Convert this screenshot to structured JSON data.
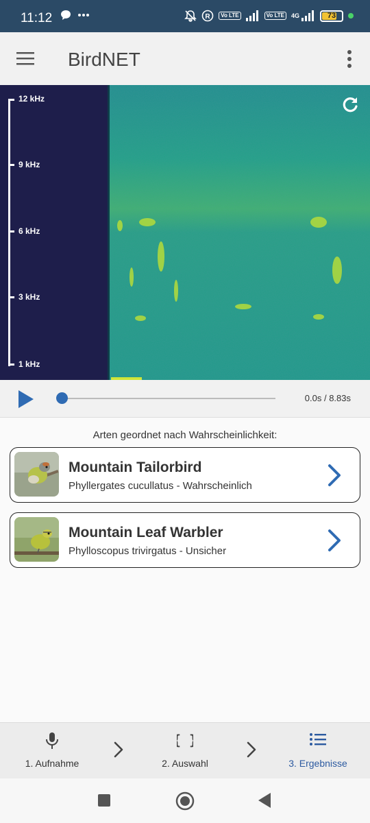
{
  "status_bar": {
    "time": "11:12",
    "battery_level": "73",
    "icons": [
      "chat-bubble-icon",
      "more-dots-icon",
      "mute-bell-icon",
      "registered-icon",
      "volte-icon",
      "signal-icon",
      "4g-icon",
      "battery-icon"
    ],
    "volte_label_1": "Vo LTE",
    "volte_label_2": "Vo LTE",
    "network_label": "4G"
  },
  "app_bar": {
    "title": "BirdNET",
    "icons": [
      "hamburger-menu-icon",
      "overflow-menu-icon"
    ]
  },
  "spectrogram": {
    "frequency_labels": [
      "12 kHz",
      "9 kHz",
      "6 kHz",
      "3 kHz",
      "1 kHz"
    ],
    "refresh_icon": "refresh-icon"
  },
  "player": {
    "time_display": "0.0s / 8.83s",
    "progress": 0.0,
    "play_icon": "play-icon"
  },
  "results": {
    "heading": "Arten geordnet nach Wahrscheinlichkeit:",
    "items": [
      {
        "common_name": "Mountain Tailorbird",
        "detail": "Phyllergates cucullatus - Wahrscheinlich"
      },
      {
        "common_name": "Mountain Leaf Warbler",
        "detail": "Phylloscopus trivirgatus - Unsicher"
      }
    ]
  },
  "bottom_nav": {
    "steps": [
      {
        "label": "1. Aufnahme",
        "icon": "microphone-icon"
      },
      {
        "label": "2. Auswahl",
        "icon": "braces-icon"
      },
      {
        "label": "3. Ergebnisse",
        "icon": "list-icon"
      }
    ],
    "active_step": 2,
    "colors": {
      "active": "#2c5aa0",
      "accent": "#2f6bb3"
    }
  }
}
